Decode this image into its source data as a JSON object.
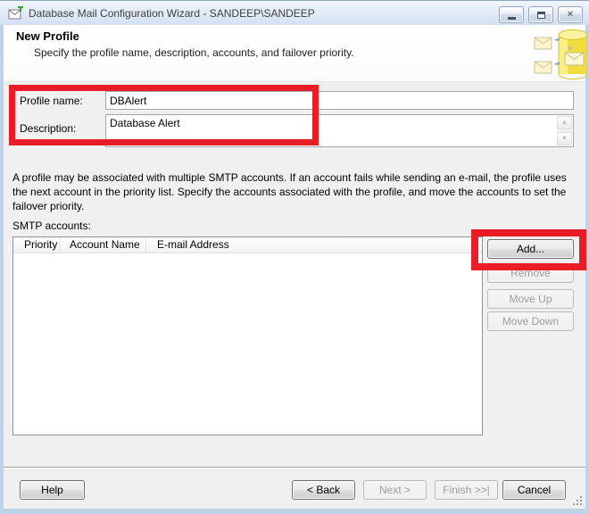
{
  "titlebar": {
    "title": "Database Mail Configuration Wizard - SANDEEP\\SANDEEP"
  },
  "icons": {
    "close": "✕",
    "scroll_up": "▲",
    "scroll_down": "▼"
  },
  "header": {
    "title": "New Profile",
    "subtitle": "Specify the profile name, description, accounts, and failover priority."
  },
  "form": {
    "profile_name_label": "Profile name:",
    "profile_name_value": "DBAlert",
    "description_label": "Description:",
    "description_value": "Database Alert"
  },
  "info_text": "A profile may be associated with multiple SMTP accounts. If an account fails while sending an e-mail, the profile uses the next account in the priority list. Specify the accounts associated with the profile, and move the accounts to set the failover priority.",
  "accounts": {
    "label": "SMTP accounts:",
    "columns": [
      "Priority",
      "Account Name",
      "E-mail Address"
    ],
    "rows": [],
    "buttons": {
      "add": "Add...",
      "remove": "Remove",
      "move_up": "Move Up",
      "move_down": "Move Down"
    }
  },
  "footer": {
    "help": "Help",
    "back": "< Back",
    "next": "Next >",
    "finish": "Finish >>|",
    "cancel": "Cancel"
  },
  "colors": {
    "annotation_red": "#e81d25",
    "content_background": "#f0f0f0",
    "window_border": "#bed3e9"
  }
}
